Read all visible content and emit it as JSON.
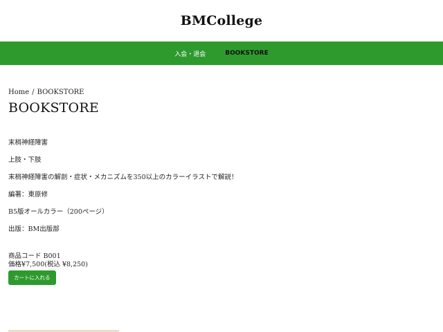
{
  "header": {
    "site_title": "BMCollege"
  },
  "nav": {
    "items": [
      {
        "label": "入会・退会"
      },
      {
        "label": "BOOKSTORE"
      }
    ]
  },
  "breadcrumb": {
    "home": "Home",
    "separator": "/",
    "current": "BOOKSTORE"
  },
  "page": {
    "title": "BOOKSTORE"
  },
  "description": [
    "末梢神経障害",
    "上肢・下肢",
    "末梢神経障害の解剖・症状・メカニズムを350以上のカラーイラストで解説！",
    "編著：東原修",
    "B5版オールカラー（200ページ）",
    "出版：BM出版部"
  ],
  "product": {
    "code": "商品コード B001",
    "price": "価格¥7,500(税込 ¥8,250)",
    "cart_button": "カートに入れる"
  },
  "colors": {
    "accent": "#2e9a2e"
  }
}
